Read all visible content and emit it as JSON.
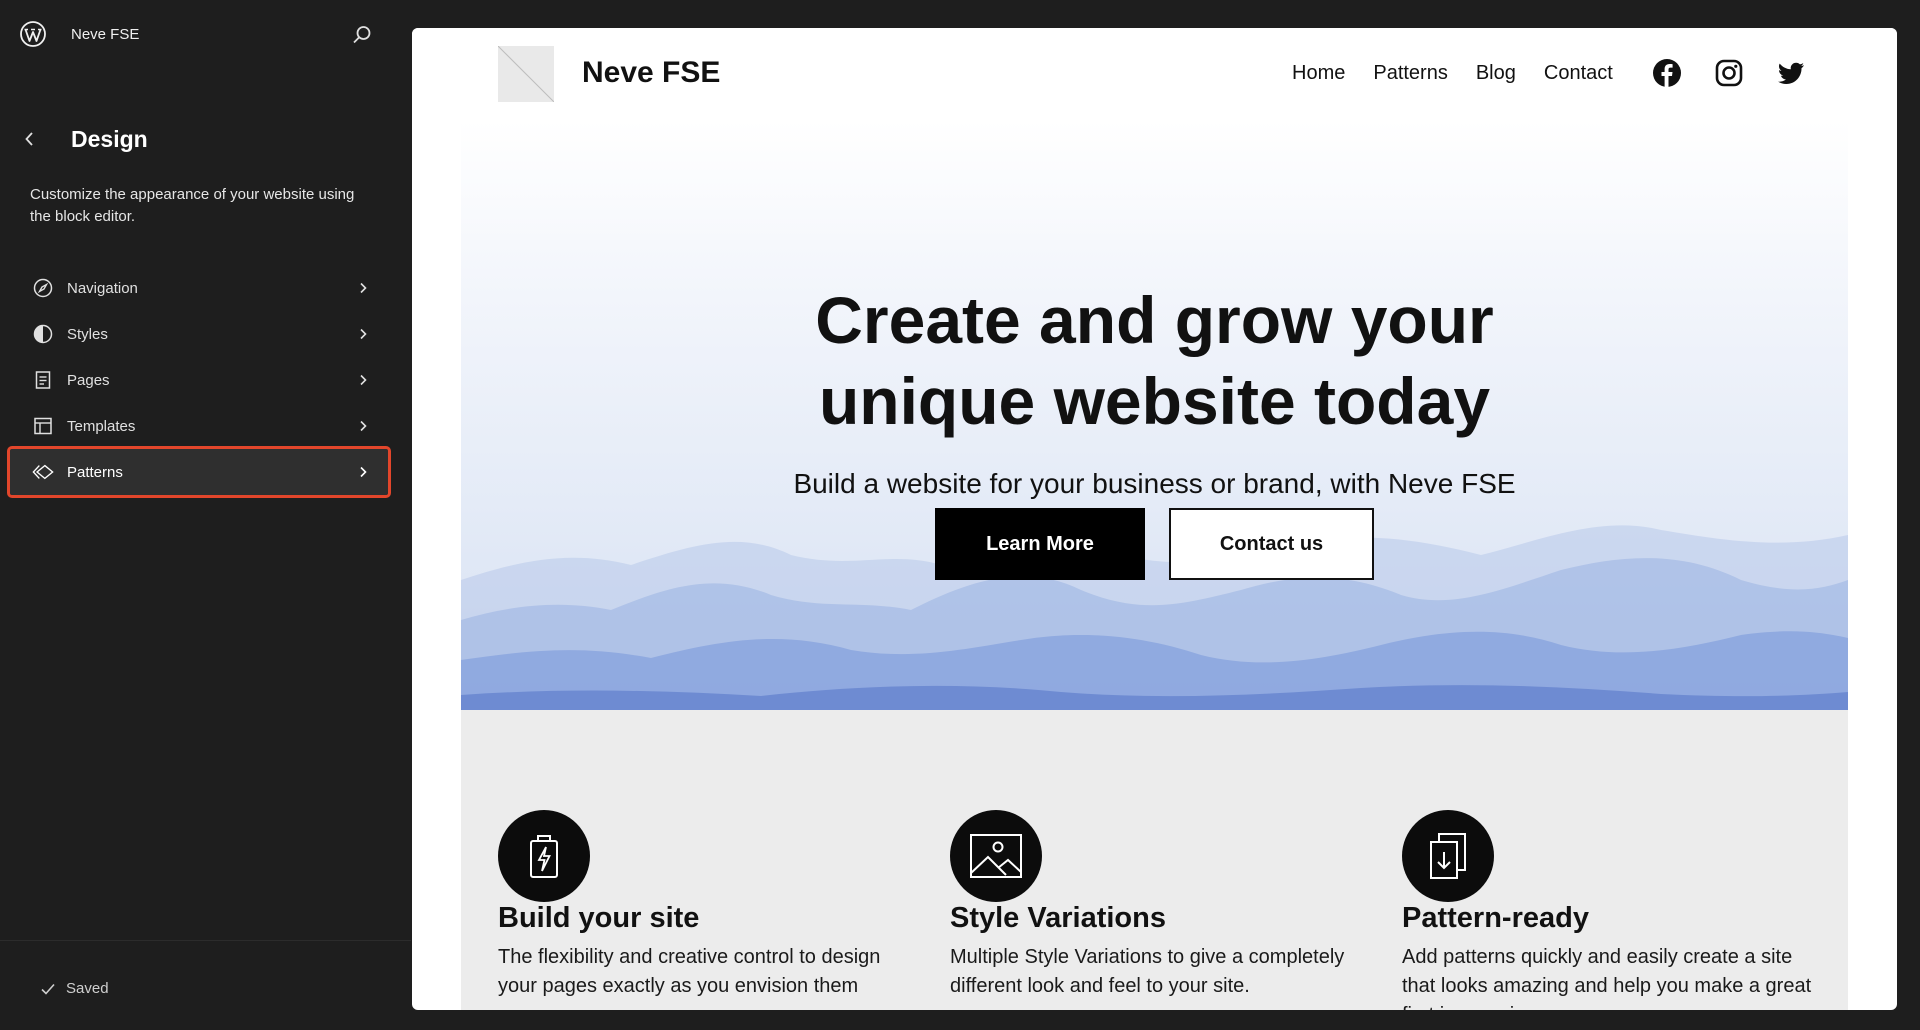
{
  "sidebar": {
    "site_name": "Neve FSE",
    "design_title": "Design",
    "design_description": "Customize the appearance of your website using the block editor.",
    "items": [
      {
        "label": "Navigation",
        "icon": "navigation-icon"
      },
      {
        "label": "Styles",
        "icon": "styles-icon"
      },
      {
        "label": "Pages",
        "icon": "pages-icon"
      },
      {
        "label": "Templates",
        "icon": "templates-icon"
      },
      {
        "label": "Patterns",
        "icon": "patterns-icon",
        "active": true
      }
    ],
    "saved_label": "Saved",
    "highlight_color": "#e2462b"
  },
  "preview": {
    "site_title": "Neve FSE",
    "nav": [
      "Home",
      "Patterns",
      "Blog",
      "Contact"
    ],
    "social_icons": [
      "facebook-icon",
      "instagram-icon",
      "twitter-icon"
    ],
    "hero": {
      "title_line1": "Create and grow your",
      "title_line2": "unique website today",
      "subtitle": "Build a website for your business or brand, with Neve FSE",
      "primary_button": "Learn More",
      "secondary_button": "Contact us"
    },
    "features": [
      {
        "icon": "battery-icon",
        "title": "Build your site",
        "text": "The flexibility and creative control to design your pages exactly as you envision them"
      },
      {
        "icon": "image-icon",
        "title": "Style Variations",
        "text": "Multiple Style Variations to give a completely different look and feel to your site."
      },
      {
        "icon": "download-document-icon",
        "title": "Pattern-ready",
        "text": "Add patterns quickly and easily create a site that looks amazing and help you make a great first impression"
      }
    ]
  }
}
